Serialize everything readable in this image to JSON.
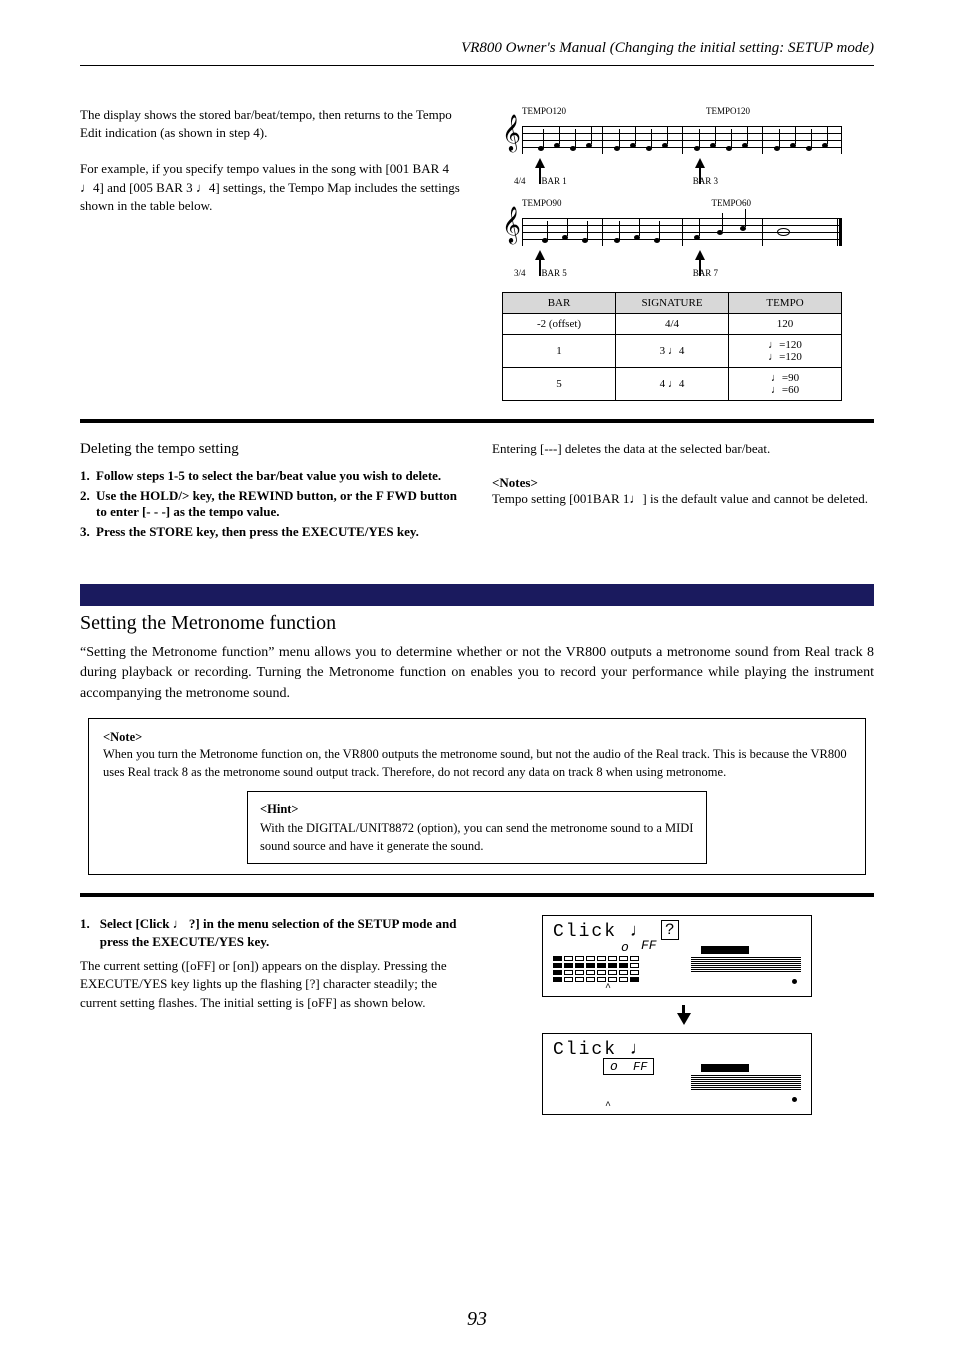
{
  "header": {
    "title": "VR800 Owner's Manual (Changing the initial setting: SETUP mode)"
  },
  "tempo": {
    "p1": "The display shows the stored bar/beat/tempo, then returns to the Tempo Edit indication (as shown in step 4).",
    "p2_a": "For example, if you specify tempo values in the song with [001 BAR 4 ",
    "p2_b": "4] and [005 BAR 3 ",
    "p2_c": "4] settings, the Tempo Map includes the settings shown in the table below.",
    "table": {
      "h_bar": "BAR",
      "h_sig": "SIGNATURE",
      "h_tempo": "TEMPO",
      "r1_bar": "-2 (offset)",
      "r1_sig": "4/4",
      "r1_tempo": "120",
      "r2_bar": "1",
      "r2_sig": "4",
      "r2_tempo_a": "=120",
      "r2_tempo_b": "=120",
      "r3_bar": "5",
      "r3_sig": "4",
      "r3_tempo_a": "=90",
      "r3_tempo_b": "=60"
    },
    "notation_labels": {
      "t120_a": "TEMPO120",
      "t120_b": "TEMPO120",
      "ts44": "4/4",
      "bar1": "BAR 1",
      "bar3": "BAR 3",
      "t90": "TEMPO90",
      "t60": "TEMPO60",
      "ts34": "3/4",
      "bar5": "BAR 5",
      "bar7": "BAR 7"
    }
  },
  "delete_section": {
    "title": "Deleting the tempo setting",
    "s1": "Follow steps 1-5 to select the bar/beat value you wish to delete.",
    "s2": "Use the HOLD/> key, the REWIND button, or the F FWD button to enter [- - -] as the tempo value.",
    "s3": "Press the STORE key, then press the EXECUTE/YES key.",
    "r1": "Entering [---] deletes the data at the selected bar/beat.",
    "note_hd": "<Notes>",
    "note_a": "Tempo setting [001BAR 1",
    "note_b": "] is the default value and cannot be deleted."
  },
  "metronome": {
    "title": "Setting the Metronome function",
    "desc": "“Setting the Metronome function” menu allows you to determine whether or not the VR800 outputs a metronome sound from Real track 8 during playback or recording.  Turning the Metronome function on enables you to record your performance while playing the instrument accompanying the metronome sound.",
    "box_note_hd": "<Note>",
    "box_note": "When you turn the Metronome function on, the VR800 outputs the metronome sound, but not the audio of the Real track. This is because the VR800 uses Real track 8 as the metronome sound output track. Therefore, do not record any data on track 8 when using metronome.",
    "box_hint_hd": "<Hint>",
    "box_hint": "With the DIGITAL/UNIT8872 (option), you can send the metronome sound to a MIDI sound source and have it generate the sound.",
    "step1_num": "1.",
    "step1_title": "Select [Click ",
    "step1_title_b": " ?] in the menu selection of the SETUP mode and press the EXECUTE/YES key.",
    "step1_body": "The current setting ([oFF] or [on]) appears on the display. Pressing the EXECUTE/YES key lights up the flashing [?] character steadily; the current setting flashes.  The initial setting is [oFF] as shown below.",
    "lcd1_text": "Click",
    "lcd1_q": "?",
    "lcd1_sub_o": "o",
    "lcd1_sub_ff": "FF",
    "lcd2_text": "Click",
    "lcd2_sub_o": "o",
    "lcd2_sub_ff": "FF"
  },
  "page_number": "93"
}
